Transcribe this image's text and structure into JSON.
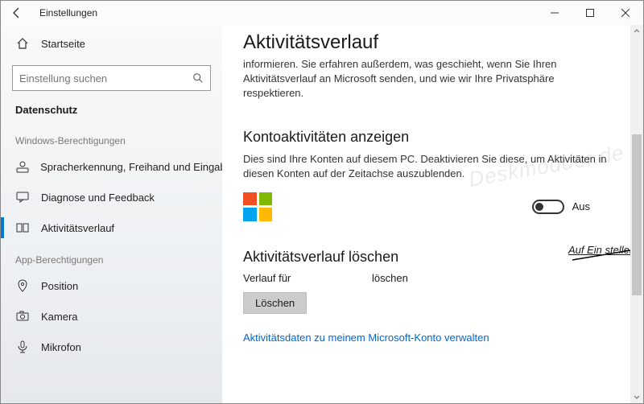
{
  "window": {
    "title": "Einstellungen"
  },
  "sidebar": {
    "home": "Startseite",
    "search_placeholder": "Einstellung suchen",
    "section": "Datenschutz",
    "group_windows": "Windows-Berechtigungen",
    "items_windows": [
      {
        "label": "Spracherkennung, Freihand und Eingabe"
      },
      {
        "label": "Diagnose und Feedback"
      },
      {
        "label": "Aktivitätsverlauf"
      }
    ],
    "group_app": "App-Berechtigungen",
    "items_app": [
      {
        "label": "Position"
      },
      {
        "label": "Kamera"
      },
      {
        "label": "Mikrofon"
      }
    ]
  },
  "main": {
    "title": "Aktivitätsverlauf",
    "intro": "informieren. Sie erfahren außerdem, was geschieht, wenn Sie Ihren Aktivitätsverlauf an Microsoft senden, und wie wir Ihre Privatsphäre respektieren.",
    "accounts_heading": "Kontoaktivitäten anzeigen",
    "accounts_desc": "Dies sind Ihre Konten auf diesem PC. Deaktivieren Sie diese, um Aktivitäten in diesen Konten auf der Zeitachse auszublenden.",
    "toggle_state": "Aus",
    "annotation": "Auf Ein stellen",
    "clear_heading": "Aktivitätsverlauf löschen",
    "clear_label_left": "Verlauf für",
    "clear_label_right": "löschen",
    "clear_button": "Löschen",
    "manage_link": "Aktivitätsdaten zu meinem Microsoft-Konto verwalten"
  },
  "watermark": "Deskmodder.de"
}
